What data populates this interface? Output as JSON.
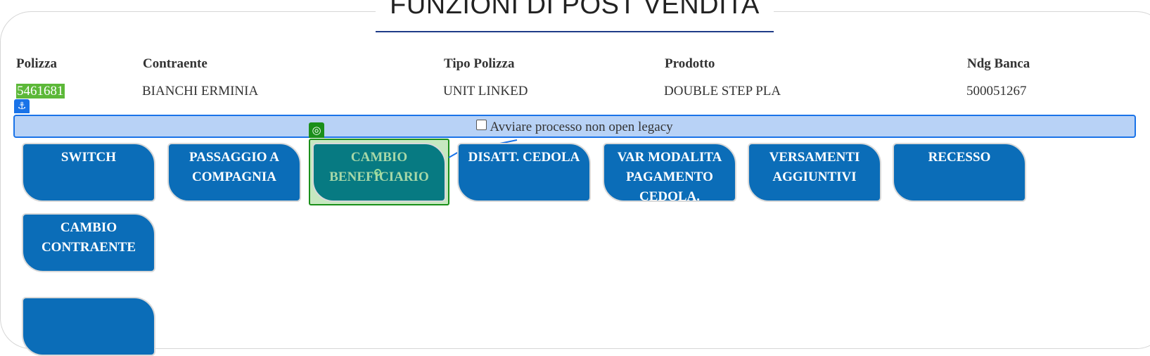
{
  "page": {
    "title": "FUNZIONI DI POST VENDITA"
  },
  "policy": {
    "headers": {
      "polizza": "Polizza",
      "contraente": "Contraente",
      "tipo_polizza": "Tipo Polizza",
      "prodotto": "Prodotto",
      "ndg_banca": "Ndg Banca"
    },
    "values": {
      "polizza": "5461681",
      "contraente": "BIANCHI ERMINIA",
      "tipo_polizza": "UNIT LINKED",
      "prodotto": "DOUBLE STEP PLA",
      "ndg_banca": "500051267"
    }
  },
  "legacy": {
    "label": "Avviare processo non open legacy",
    "checked": false
  },
  "overlay": {
    "anchor_icon": "anchor-icon",
    "target_icon": "target-icon",
    "colors": {
      "anchor": "#1a73e8",
      "selection": "#1a8f1a"
    }
  },
  "actions": [
    {
      "label": "SWITCH"
    },
    {
      "label": "PASSAGGIO A COMPAGNIA"
    },
    {
      "label": "CAMBIO BENEFICIARIO",
      "selected": true
    },
    {
      "label": "DISATT. CEDOLA"
    },
    {
      "label": "VAR MODALITA PAGAMENTO CEDOLA."
    },
    {
      "label": "VERSAMENTI AGGIUNTIVI"
    },
    {
      "label": "RECESSO"
    },
    {
      "label": "CAMBIO CONTRAENTE"
    }
  ],
  "colors": {
    "button": "#0b6db8",
    "button_selected": "#077a82",
    "title_underline": "#1f3c88",
    "policy_highlight": "#5cb838"
  }
}
